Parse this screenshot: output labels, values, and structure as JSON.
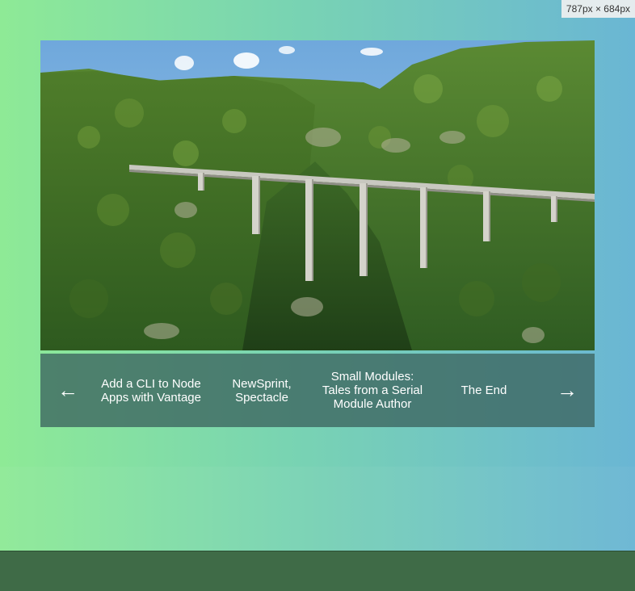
{
  "viewport_badge": "787px × 684px",
  "hero": {
    "image_icon": "landscape-photo-viaduct"
  },
  "carousel": {
    "prev_arrow": "←",
    "next_arrow": "→",
    "items": [
      {
        "title": "Add a CLI to Node Apps with Vantage"
      },
      {
        "title": "NewSprint, Spectacle"
      },
      {
        "title": "Small Modules: Tales from a Serial Module Author"
      },
      {
        "title": "The End"
      }
    ]
  },
  "colors": {
    "gradient_start": "#8eea96",
    "gradient_end": "#6ab6d4",
    "carousel_bg": "#3c645f",
    "bottom_strip": "#3f6b47"
  }
}
